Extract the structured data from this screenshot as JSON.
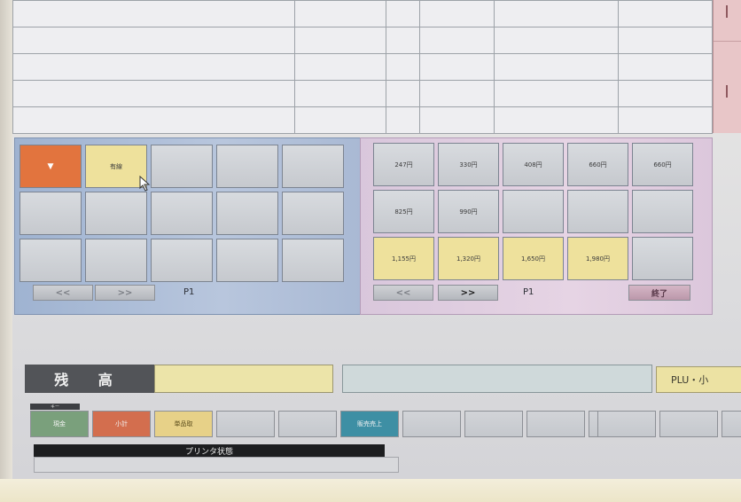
{
  "left_panel": {
    "keys": [
      {
        "label": "▼",
        "style": "orange"
      },
      {
        "label": "有線",
        "style": "yellow"
      },
      {
        "label": "",
        "style": "gray"
      },
      {
        "label": "",
        "style": "gray"
      },
      {
        "label": "",
        "style": "gray"
      },
      {
        "label": "",
        "style": "gray"
      },
      {
        "label": "",
        "style": "gray"
      },
      {
        "label": "",
        "style": "gray"
      },
      {
        "label": "",
        "style": "gray"
      },
      {
        "label": "",
        "style": "gray"
      },
      {
        "label": "",
        "style": "gray"
      },
      {
        "label": "",
        "style": "gray"
      },
      {
        "label": "",
        "style": "gray"
      },
      {
        "label": "",
        "style": "gray"
      },
      {
        "label": "",
        "style": "gray"
      }
    ],
    "prev": "<<",
    "next": ">>",
    "page": "P1"
  },
  "right_panel": {
    "keys": [
      {
        "label": "247円",
        "style": "gray"
      },
      {
        "label": "330円",
        "style": "gray"
      },
      {
        "label": "408円",
        "style": "gray"
      },
      {
        "label": "660円",
        "style": "gray"
      },
      {
        "label": "660円",
        "style": "gray"
      },
      {
        "label": "825円",
        "style": "gray"
      },
      {
        "label": "990円",
        "style": "gray"
      },
      {
        "label": "",
        "style": "gray"
      },
      {
        "label": "",
        "style": "gray"
      },
      {
        "label": "",
        "style": "gray"
      },
      {
        "label": "1,155円",
        "style": "yellow"
      },
      {
        "label": "1,320円",
        "style": "yellow"
      },
      {
        "label": "1,650円",
        "style": "yellow"
      },
      {
        "label": "1,980円",
        "style": "yellow"
      },
      {
        "label": "",
        "style": "gray"
      }
    ],
    "prev": "<<",
    "next": ">>",
    "page": "P1",
    "end": "終了"
  },
  "balance": {
    "label": "残 高",
    "value": "",
    "message": ""
  },
  "plu_button": "PLU・小",
  "function_keys": {
    "header": "キー",
    "left": [
      {
        "label": "現金",
        "style": "green"
      },
      {
        "label": "小計",
        "style": "red"
      },
      {
        "label": "単品取",
        "style": "yellow"
      },
      {
        "label": "",
        "style": "gray"
      },
      {
        "label": "",
        "style": "gray"
      }
    ],
    "middle": [
      {
        "label": "販売売上",
        "style": "teal"
      },
      {
        "label": "",
        "style": "gray"
      },
      {
        "label": "",
        "style": "gray"
      },
      {
        "label": "",
        "style": "gray"
      },
      {
        "label": "",
        "style": "gray"
      }
    ],
    "right": [
      {
        "label": "",
        "style": "gray"
      },
      {
        "label": "",
        "style": "gray"
      },
      {
        "label": "",
        "style": "gray"
      }
    ]
  },
  "printer_status": {
    "label": "プリンタ状態",
    "value": ""
  },
  "colors": {
    "orange_key": "#e2743e",
    "yellow_key": "#eee19c",
    "left_panel": "#a9b9d4",
    "right_panel": "#dcc7dc"
  }
}
